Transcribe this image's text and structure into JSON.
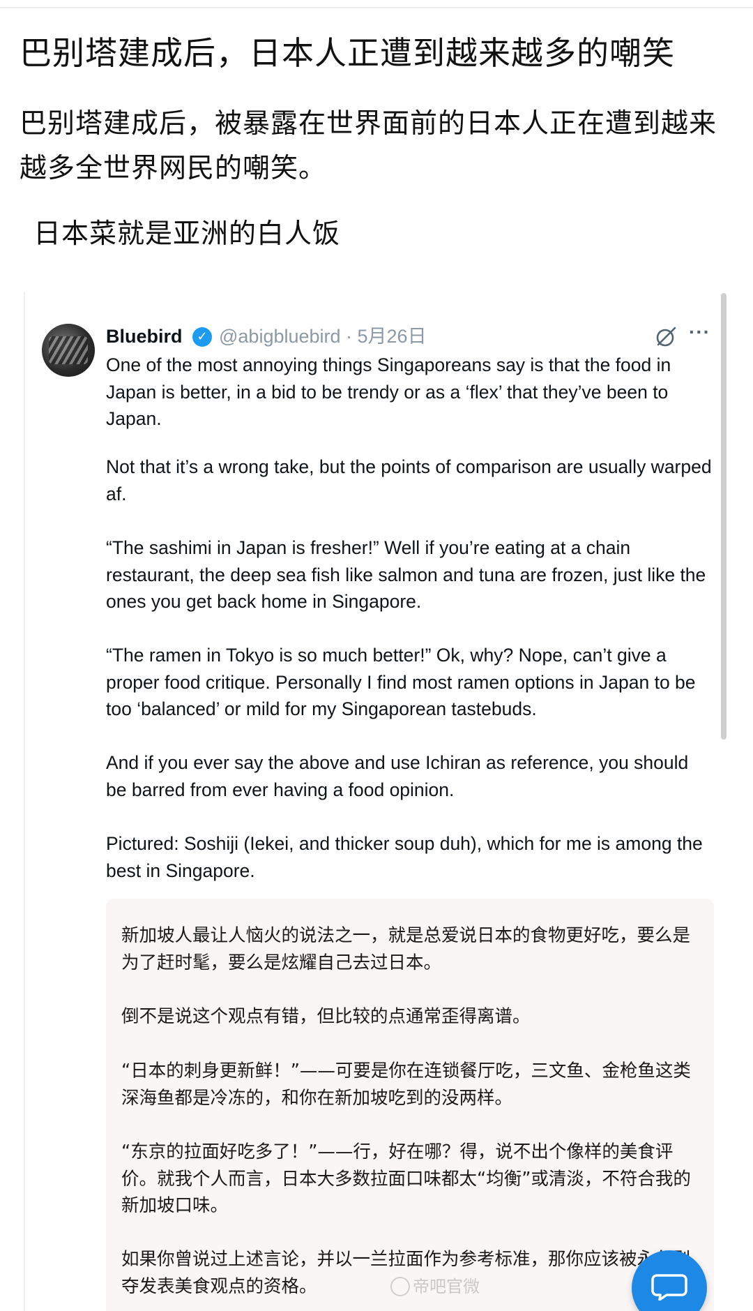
{
  "post": {
    "title": "巴别塔建成后，日本人正遭到越来越多的嘲笑",
    "body": "巴别塔建成后，被暴露在世界面前的日本人正在遭到越来越多全世界网民的嘲笑。",
    "line": "日本菜就是亚洲的白人饭"
  },
  "tweet": {
    "name": "Bluebird",
    "handle_date": "@abigbluebird · 5月26日",
    "more": "···",
    "paragraphs": [
      "One of the most annoying things Singaporeans say is that the food in Japan is better, in a bid to be trendy or as a ‘flex’ that they’ve been to Japan.",
      "Not that it’s a wrong take, but the points of comparison are usually warped af.",
      "“The sashimi in Japan is fresher!” Well if you’re eating at a chain restaurant, the deep sea fish like salmon and tuna are frozen, just like the ones you get back home in Singapore.",
      "“The ramen in Tokyo is so much better!” Ok, why? Nope, can’t give a proper food critique. Personally I find most ramen options in Japan to be too ‘balanced’ or mild for my Singaporean tastebuds.",
      "And if you ever say the above and use Ichiran as reference, you should be barred from ever having a food opinion.",
      "Pictured: Soshiji (Iekei, and thicker soup duh), which for me is among the best in Singapore."
    ],
    "translation": [
      "新加坡人最让人恼火的说法之一，就是总爱说日本的食物更好吃，要么是为了赶时髦，要么是炫耀自己去过日本。",
      "倒不是说这个观点有错，但比较的点通常歪得离谱。",
      "“日本的刺身更新鲜！”——可要是你在连锁餐厅吃，三文鱼、金枪鱼这类深海鱼都是冷冻的，和你在新加坡吃到的没两样。",
      "“东京的拉面好吃多了！”——行，好在哪？得，说不出个像样的美食评价。就我个人而言，日本大多数拉面口味都太“均衡”或清淡，不符合我的新加坡口味。",
      "如果你曾说过上述言论，并以一兰拉面作为参考标准，那你应该被永久剥夺发表美食观点的资格。"
    ]
  },
  "watermark": "帝吧官微",
  "colors": {
    "accent_blue": "#1e88e5",
    "verified_blue": "#1d9bf0",
    "translation_bg": "#fbf6f6",
    "meta_gray": "#8b98a5"
  },
  "icons": {
    "verified": "verified-badge-icon",
    "grok": "grok-icon",
    "more": "more-options-icon",
    "fab": "comment-bubble-icon"
  }
}
